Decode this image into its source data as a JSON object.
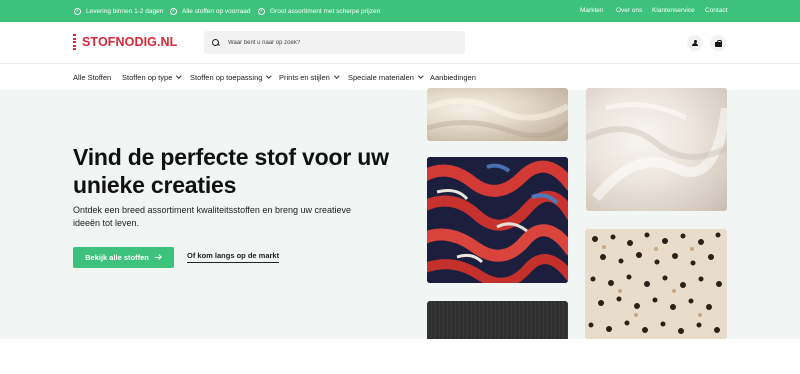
{
  "usps": [
    {
      "label": "Levering binnen 1-2 dagen"
    },
    {
      "label": "Alle stoffen op voorraad"
    },
    {
      "label": "Groot assortiment met scherpe prijzen"
    }
  ],
  "top_links": [
    "Markten",
    "Over ons",
    "Klantenservice",
    "Contact"
  ],
  "logo": {
    "text": "STOFNODIG.NL"
  },
  "search": {
    "placeholder": "Waar bent u naar op zoek?"
  },
  "nav": [
    {
      "label": "Alle Stoffen",
      "dropdown": false
    },
    {
      "label": "Stoffen op type",
      "dropdown": true
    },
    {
      "label": "Stoffen op toepassing",
      "dropdown": true
    },
    {
      "label": "Prints en stijlen",
      "dropdown": true
    },
    {
      "label": "Speciale materialen",
      "dropdown": true
    },
    {
      "label": "Aanbiedingen",
      "dropdown": false
    }
  ],
  "hero": {
    "title": "Vind de perfecte stof voor uw unieke creaties",
    "subtitle": "Ontdek een breed assortiment kwaliteitsstoffen en breng uw creatieve ideeën tot leven.",
    "primary_button": "Bekijk alle stoffen",
    "secondary_link": "Of kom langs op de markt"
  },
  "colors": {
    "brand_green": "#3cc27a",
    "logo_red": "#d9283a",
    "hero_bg": "#f1f5f3"
  },
  "icons": [
    "check-icon",
    "search-icon",
    "user-icon",
    "cart-icon",
    "chevron-down-icon",
    "arrow-right-icon"
  ]
}
